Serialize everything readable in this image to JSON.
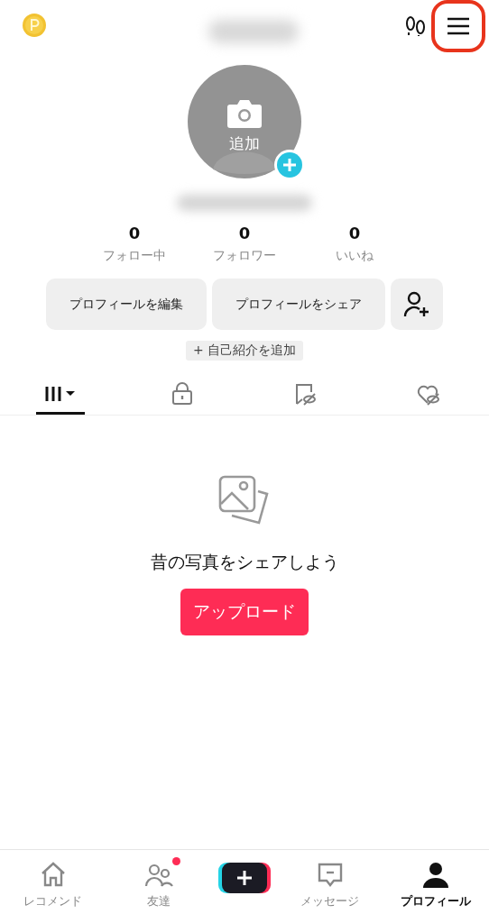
{
  "top_bar": {
    "menu_highlighted": true
  },
  "avatar": {
    "label": "追加"
  },
  "stats": [
    {
      "value": "0",
      "label": "フォロー中"
    },
    {
      "value": "0",
      "label": "フォロワー"
    },
    {
      "value": "0",
      "label": "いいね"
    }
  ],
  "actions": [
    {
      "kind": "text",
      "label": "プロフィールを編集"
    },
    {
      "kind": "text",
      "label": "プロフィールをシェア"
    },
    {
      "kind": "add-friend"
    }
  ],
  "bio_button": "+ 自己紹介を追加",
  "tabs": [
    {
      "kind": "grid",
      "selected": true
    },
    {
      "kind": "lock",
      "selected": false
    },
    {
      "kind": "bookmark",
      "selected": false
    },
    {
      "kind": "heart",
      "selected": false
    }
  ],
  "empty_state": {
    "message": "昔の写真をシェアしよう",
    "button": "アップロード"
  },
  "nav": [
    {
      "kind": "home",
      "label": "レコメンド",
      "selected": false,
      "badge": false
    },
    {
      "kind": "friends",
      "label": "友達",
      "selected": false,
      "badge": true
    },
    {
      "kind": "create"
    },
    {
      "kind": "inbox",
      "label": "メッセージ",
      "selected": false,
      "badge": false
    },
    {
      "kind": "profile",
      "label": "プロフィール",
      "selected": true,
      "badge": false
    }
  ]
}
